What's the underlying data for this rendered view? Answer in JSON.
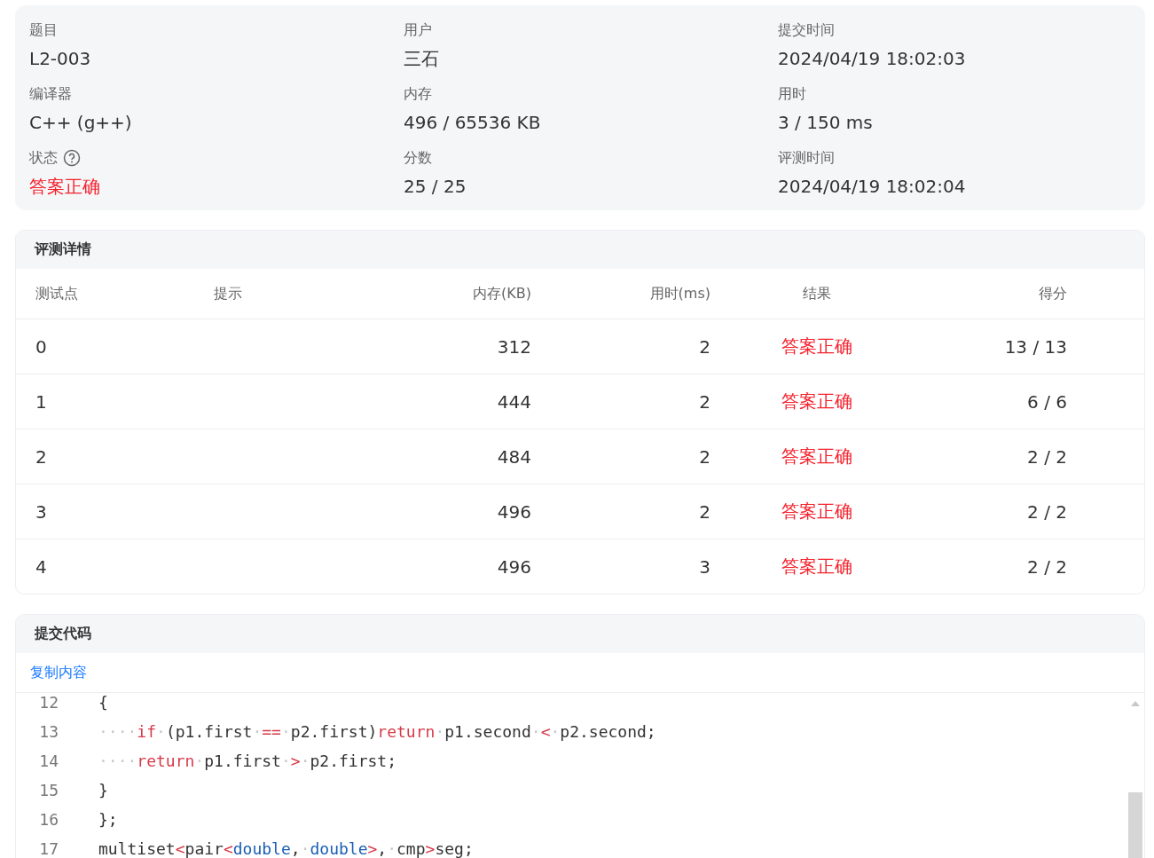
{
  "summary": [
    {
      "label": "题目",
      "value": "L2-003",
      "kind": "text"
    },
    {
      "label": "用户",
      "value": "三石",
      "kind": "text"
    },
    {
      "label": "提交时间",
      "value": "2024/04/19 18:02:03",
      "kind": "text"
    },
    {
      "label": "编译器",
      "value": "C++ (g++)",
      "kind": "text"
    },
    {
      "label": "内存",
      "value": "496 / 65536 KB",
      "kind": "text"
    },
    {
      "label": "用时",
      "value": "3 / 150 ms",
      "kind": "text"
    },
    {
      "label": "状态",
      "value": "答案正确",
      "kind": "status"
    },
    {
      "label": "分数",
      "value": "25 / 25",
      "kind": "text"
    },
    {
      "label": "评测时间",
      "value": "2024/04/19 18:02:04",
      "kind": "text"
    }
  ],
  "judge_details": {
    "title": "评测详情",
    "columns": [
      "测试点",
      "提示",
      "内存(KB)",
      "用时(ms)",
      "结果",
      "得分"
    ],
    "rows": [
      {
        "case": "0",
        "hint": "",
        "memory": "312",
        "time": "2",
        "result": "答案正确",
        "score": "13 / 13"
      },
      {
        "case": "1",
        "hint": "",
        "memory": "444",
        "time": "2",
        "result": "答案正确",
        "score": "6 / 6"
      },
      {
        "case": "2",
        "hint": "",
        "memory": "484",
        "time": "2",
        "result": "答案正确",
        "score": "2 / 2"
      },
      {
        "case": "3",
        "hint": "",
        "memory": "496",
        "time": "2",
        "result": "答案正确",
        "score": "2 / 2"
      },
      {
        "case": "4",
        "hint": "",
        "memory": "496",
        "time": "3",
        "result": "答案正确",
        "score": "2 / 2"
      }
    ]
  },
  "submitted_code": {
    "title": "提交代码",
    "copy_link": "复制内容",
    "lines": [
      {
        "number": "12",
        "tokens": [
          {
            "kind": "plain",
            "text": "{"
          }
        ]
      },
      {
        "number": "13",
        "tokens": [
          {
            "kind": "whitespace",
            "text": "····"
          },
          {
            "kind": "keyword",
            "text": "if"
          },
          {
            "kind": "whitespace",
            "text": "·"
          },
          {
            "kind": "plain",
            "text": "(p1.first"
          },
          {
            "kind": "whitespace",
            "text": "·"
          },
          {
            "kind": "operator",
            "text": "=="
          },
          {
            "kind": "whitespace",
            "text": "·"
          },
          {
            "kind": "plain",
            "text": "p2.first)"
          },
          {
            "kind": "keyword",
            "text": "return"
          },
          {
            "kind": "whitespace",
            "text": "·"
          },
          {
            "kind": "plain",
            "text": "p1.second"
          },
          {
            "kind": "whitespace",
            "text": "·"
          },
          {
            "kind": "operator",
            "text": "<"
          },
          {
            "kind": "whitespace",
            "text": "·"
          },
          {
            "kind": "plain",
            "text": "p2.second;"
          }
        ]
      },
      {
        "number": "14",
        "tokens": [
          {
            "kind": "whitespace",
            "text": "····"
          },
          {
            "kind": "keyword",
            "text": "return"
          },
          {
            "kind": "whitespace",
            "text": "·"
          },
          {
            "kind": "plain",
            "text": "p1.first"
          },
          {
            "kind": "whitespace",
            "text": "·"
          },
          {
            "kind": "operator",
            "text": ">"
          },
          {
            "kind": "whitespace",
            "text": "·"
          },
          {
            "kind": "plain",
            "text": "p2.first;"
          }
        ]
      },
      {
        "number": "15",
        "tokens": [
          {
            "kind": "plain",
            "text": "}"
          }
        ]
      },
      {
        "number": "16",
        "tokens": [
          {
            "kind": "plain",
            "text": "};"
          }
        ]
      },
      {
        "number": "17",
        "tokens": [
          {
            "kind": "plain",
            "text": "multiset"
          },
          {
            "kind": "operator",
            "text": "<"
          },
          {
            "kind": "plain",
            "text": "pair"
          },
          {
            "kind": "operator",
            "text": "<"
          },
          {
            "kind": "type",
            "text": "double"
          },
          {
            "kind": "plain",
            "text": ","
          },
          {
            "kind": "whitespace",
            "text": "·"
          },
          {
            "kind": "type",
            "text": "double"
          },
          {
            "kind": "operator",
            "text": ">"
          },
          {
            "kind": "plain",
            "text": ","
          },
          {
            "kind": "whitespace",
            "text": "·"
          },
          {
            "kind": "plain",
            "text": "cmp"
          },
          {
            "kind": "operator",
            "text": ">"
          },
          {
            "kind": "plain",
            "text": "seg;"
          }
        ]
      }
    ]
  }
}
